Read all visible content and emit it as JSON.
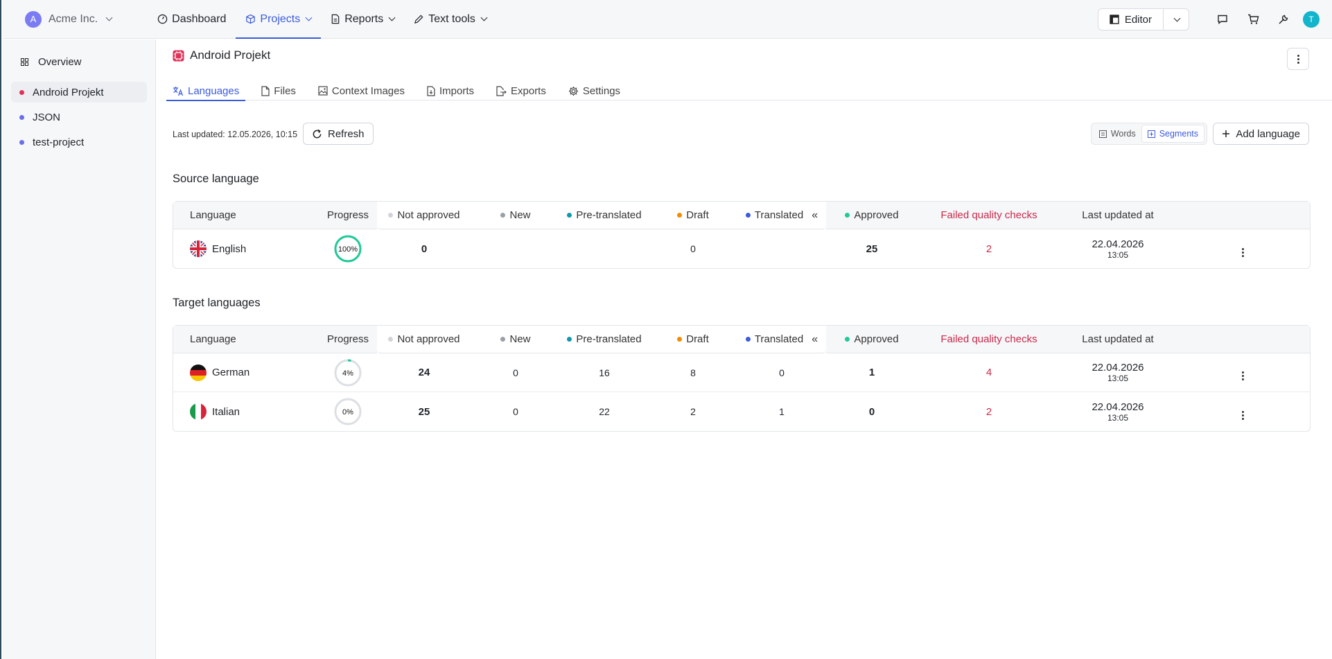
{
  "org": {
    "initial": "A",
    "name": "Acme Inc."
  },
  "nav": [
    {
      "label": "Dashboard",
      "icon": "dashboard-icon",
      "active": false,
      "dropdown": false
    },
    {
      "label": "Projects",
      "icon": "cube-icon",
      "active": true,
      "dropdown": true
    },
    {
      "label": "Reports",
      "icon": "document-icon",
      "active": false,
      "dropdown": true
    },
    {
      "label": "Text tools",
      "icon": "pencil-icon",
      "active": false,
      "dropdown": true
    }
  ],
  "topright": {
    "editor_label": "Editor",
    "avatar_initial": "T"
  },
  "sidebar": {
    "overview": "Overview",
    "items": [
      {
        "label": "Android Projekt",
        "dot": "#e03158",
        "active": true
      },
      {
        "label": "JSON",
        "dot": "#6b6ee8",
        "active": false
      },
      {
        "label": "test-project",
        "dot": "#6b6ee8",
        "active": false
      }
    ]
  },
  "project": {
    "title": "Android Projekt"
  },
  "tabs": [
    {
      "label": "Languages",
      "icon": "translate-icon",
      "active": true
    },
    {
      "label": "Files",
      "icon": "file-icon",
      "active": false
    },
    {
      "label": "Context Images",
      "icon": "image-icon",
      "active": false
    },
    {
      "label": "Imports",
      "icon": "import-icon",
      "active": false
    },
    {
      "label": "Exports",
      "icon": "export-icon",
      "active": false
    },
    {
      "label": "Settings",
      "icon": "gear-icon",
      "active": false
    }
  ],
  "toolbar": {
    "last_updated": "Last updated: 12.05.2026, 10:15",
    "refresh_label": "Refresh",
    "words_label": "Words",
    "segments_label": "Segments",
    "add_language_label": "Add language"
  },
  "columns": {
    "language": "Language",
    "progress": "Progress",
    "not_approved": "Not approved",
    "new": "New",
    "pre_translated": "Pre-translated",
    "draft": "Draft",
    "translated": "Translated",
    "approved": "Approved",
    "failed": "Failed quality checks",
    "last_updated": "Last updated at"
  },
  "status_colors": {
    "not_approved": "#d0d3d8",
    "new": "#9aa0a6",
    "pre_translated": "#1098ad",
    "draft": "#f08c00",
    "translated": "#3b5bdb",
    "approved": "#20c997",
    "failed": "#c92a4b"
  },
  "source": {
    "heading": "Source language",
    "rows": [
      {
        "language": "English",
        "flag": "gb-flag-icon",
        "progress": 100,
        "progress_label": "100%",
        "not_approved": "0",
        "new": "",
        "pre_translated": "",
        "draft": "0",
        "translated": "",
        "approved": "25",
        "failed": "2",
        "date": "22.04.2026",
        "time": "13:05"
      }
    ]
  },
  "target": {
    "heading": "Target languages",
    "rows": [
      {
        "language": "German",
        "flag": "de-flag-icon",
        "progress": 4,
        "progress_label": "4%",
        "not_approved": "24",
        "new": "0",
        "pre_translated": "16",
        "draft": "8",
        "translated": "0",
        "approved": "1",
        "failed": "4",
        "date": "22.04.2026",
        "time": "13:05"
      },
      {
        "language": "Italian",
        "flag": "it-flag-icon",
        "progress": 0,
        "progress_label": "0%",
        "not_approved": "25",
        "new": "0",
        "pre_translated": "22",
        "draft": "2",
        "translated": "1",
        "approved": "0",
        "failed": "2",
        "date": "22.04.2026",
        "time": "13:05"
      }
    ]
  }
}
